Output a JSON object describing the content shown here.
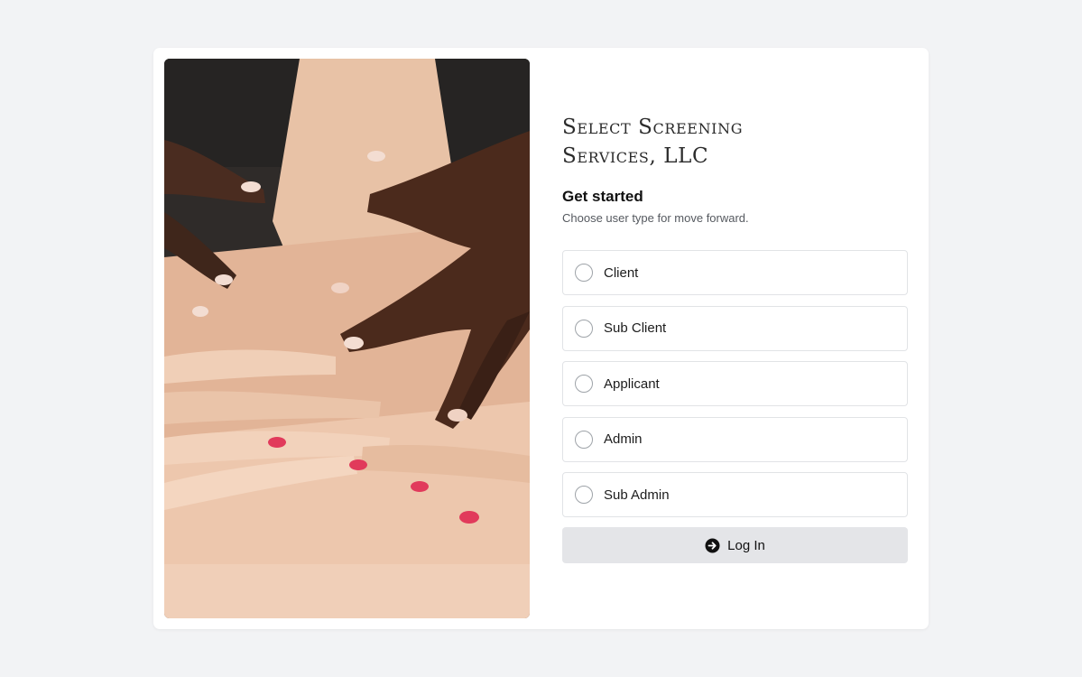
{
  "brand": {
    "line1": "Select Screening",
    "line2": "Services, LLC"
  },
  "intro": {
    "heading": "Get started",
    "subheading": "Choose user type for move forward."
  },
  "user_types": [
    {
      "label": "Client",
      "selected": false
    },
    {
      "label": "Sub Client",
      "selected": false
    },
    {
      "label": "Applicant",
      "selected": false
    },
    {
      "label": "Admin",
      "selected": false
    },
    {
      "label": "Sub Admin",
      "selected": false
    }
  ],
  "login": {
    "label": "Log In",
    "icon": "arrow-circle-right-icon"
  },
  "colors": {
    "page_background": "#f2f3f5",
    "card_background": "#ffffff",
    "button_background": "#e4e5e8"
  }
}
